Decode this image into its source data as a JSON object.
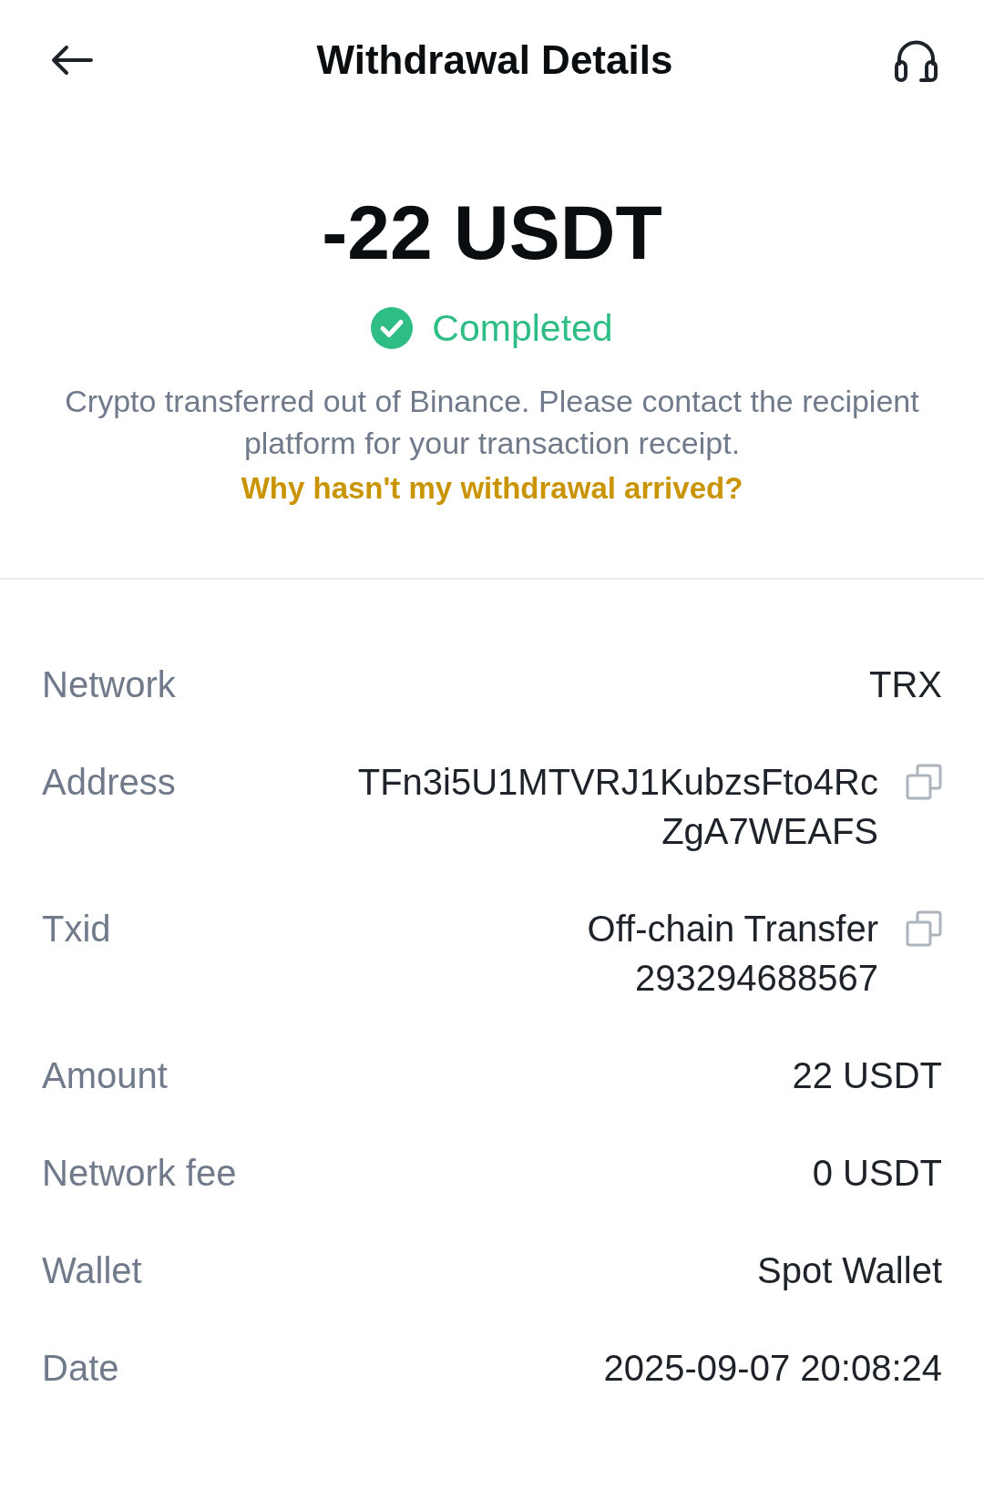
{
  "header": {
    "title": "Withdrawal Details"
  },
  "summary": {
    "amount": "-22 USDT",
    "status": {
      "label": "Completed",
      "kind": "completed"
    },
    "message": "Crypto transferred out of Binance. Please contact the recipient platform for your transaction receipt.",
    "help_link": "Why hasn't my withdrawal arrived?"
  },
  "details": [
    {
      "label": "Network",
      "value_lines": [
        "TRX"
      ],
      "copyable": false
    },
    {
      "label": "Address",
      "value_lines": [
        "TFn3i5U1MTVRJ1KubzsFto4Rc",
        "ZgA7WEAFS"
      ],
      "copyable": true
    },
    {
      "label": "Txid",
      "value_lines": [
        "Off-chain Transfer",
        "293294688567"
      ],
      "copyable": true
    },
    {
      "label": "Amount",
      "value_lines": [
        "22 USDT"
      ],
      "copyable": false
    },
    {
      "label": "Network fee",
      "value_lines": [
        "0 USDT"
      ],
      "copyable": false
    },
    {
      "label": "Wallet",
      "value_lines": [
        "Spot Wallet"
      ],
      "copyable": false
    },
    {
      "label": "Date",
      "value_lines": [
        "2025-09-07 20:08:24"
      ],
      "copyable": false
    }
  ]
}
